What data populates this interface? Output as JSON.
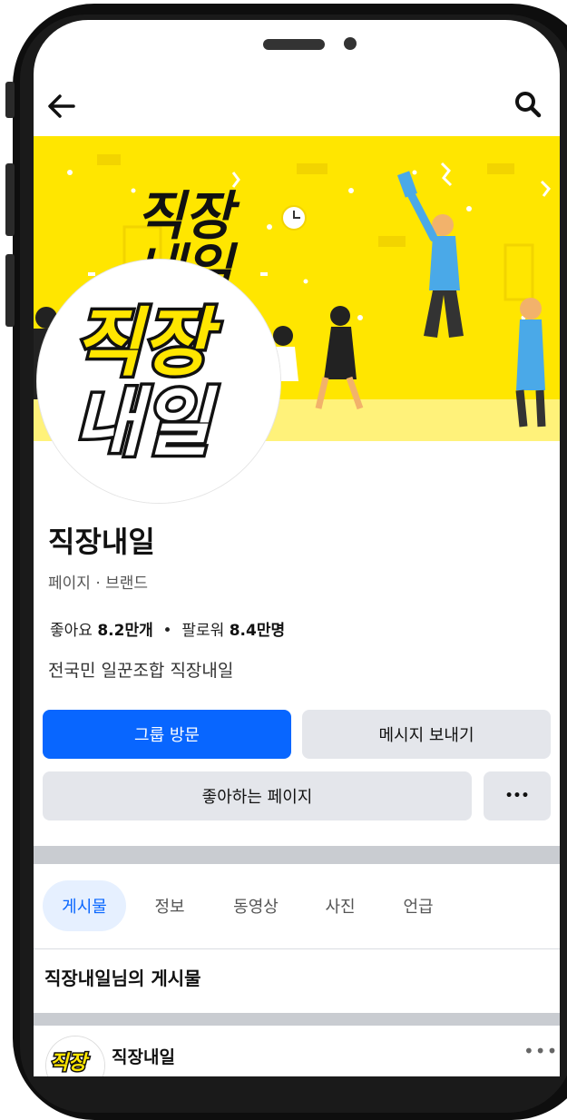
{
  "page": {
    "title": "직장내일",
    "category": "페이지 · 브랜드",
    "likes_label": "좋아요",
    "likes_value": "8.2만개",
    "followers_label": "팔로워",
    "followers_value": "8.4만명",
    "separator": "•",
    "bio": "전국민 일꾼조합 직장내일"
  },
  "cover": {
    "logo_line1": "직장",
    "logo_line2": "내일"
  },
  "avatar": {
    "logo_line1": "직장",
    "logo_line2": "내일"
  },
  "actions": {
    "visit_group": "그룹 방문",
    "send_message": "메시지 보내기",
    "liked_page": "좋아하는 페이지",
    "more": "•••"
  },
  "tabs": [
    "게시물",
    "정보",
    "동영상",
    "사진",
    "언급"
  ],
  "posts_section": {
    "title": "직장내일님의 게시물"
  },
  "post": {
    "author": "직장내일",
    "more": "•••",
    "avatar_text": "직장"
  },
  "colors": {
    "brand_yellow": "#ffe600",
    "accent_blue": "#0866ff",
    "tab_active_bg": "#e6f0ff"
  }
}
